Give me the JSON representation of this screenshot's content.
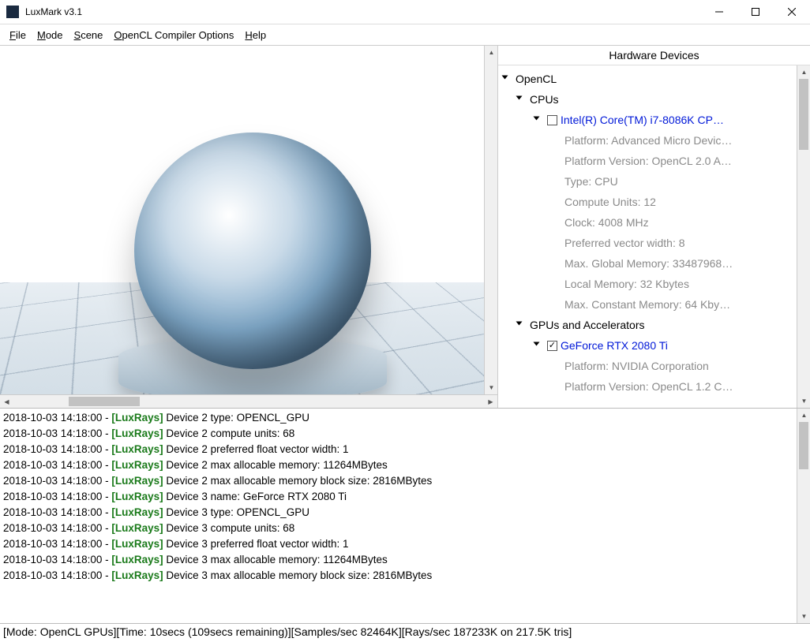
{
  "window": {
    "title": "LuxMark v3.1"
  },
  "menu": {
    "file": "File",
    "file_u": "F",
    "mode": "Mode",
    "mode_u": "M",
    "scene": "Scene",
    "scene_u": "S",
    "opencl": "OpenCL Compiler Options",
    "opencl_u": "O",
    "help": "Help",
    "help_u": "H"
  },
  "hardware": {
    "header": "Hardware Devices",
    "root": "OpenCL",
    "cpus_label": "CPUs",
    "cpu": {
      "name": "Intel(R) Core(TM) i7-8086K CP…",
      "checked": false,
      "details": [
        "Platform: Advanced Micro Devic…",
        "Platform Version: OpenCL 2.0 A…",
        "Type: CPU",
        "Compute Units: 12",
        "Clock: 4008 MHz",
        "Preferred vector width: 8",
        "Max. Global Memory: 33487968…",
        "Local Memory: 32 Kbytes",
        "Max. Constant Memory: 64 Kby…"
      ]
    },
    "gpus_label": "GPUs and Accelerators",
    "gpu": {
      "name": "GeForce RTX 2080 Ti",
      "checked": true,
      "details": [
        "Platform: NVIDIA Corporation",
        "Platform Version: OpenCL 1.2 C…"
      ]
    }
  },
  "log": {
    "timestamp": "2018-10-03 14:18:00",
    "tag": "[LuxRays]",
    "lines": [
      "Device 2 type: OPENCL_GPU",
      "Device 2 compute units: 68",
      "Device 2 preferred float vector width: 1",
      "Device 2 max allocable memory: 11264MBytes",
      "Device 2 max allocable memory block size: 2816MBytes",
      "Device 3 name: GeForce RTX 2080 Ti",
      "Device 3 type: OPENCL_GPU",
      "Device 3 compute units: 68",
      "Device 3 preferred float vector width: 1",
      "Device 3 max allocable memory: 11264MBytes",
      "Device 3 max allocable memory block size: 2816MBytes"
    ]
  },
  "status": "[Mode: OpenCL GPUs][Time: 10secs (109secs remaining)][Samples/sec  82464K][Rays/sec  187233K on 217.5K tris]"
}
